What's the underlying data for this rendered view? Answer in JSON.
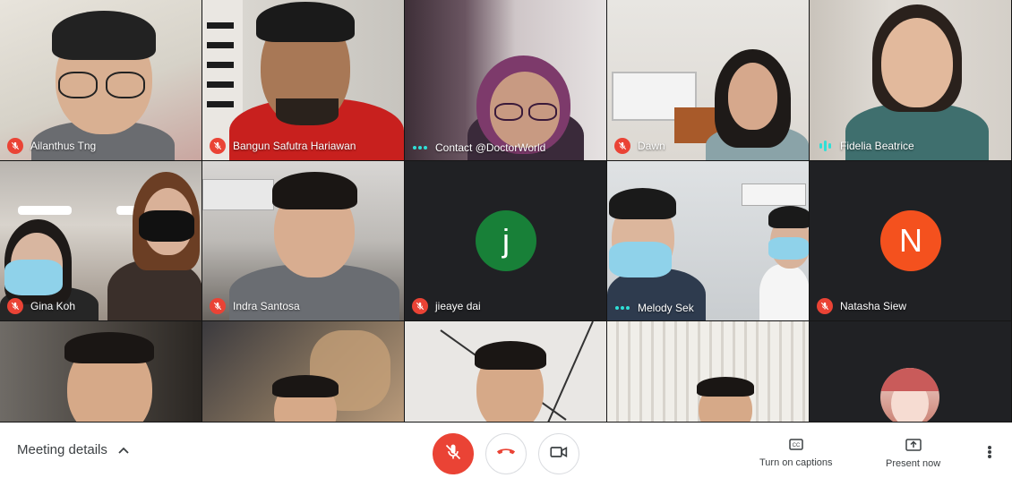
{
  "participants": [
    {
      "name": "Ailanthus Tng",
      "status": "muted"
    },
    {
      "name": "Bangun Safutra Hariawan",
      "status": "muted"
    },
    {
      "name": "Contact @DoctorWorld",
      "status": "connecting"
    },
    {
      "name": "Dawn",
      "status": "muted"
    },
    {
      "name": "Fidelia Beatrice",
      "status": "speaking"
    },
    {
      "name": "Gina Koh",
      "status": "muted"
    },
    {
      "name": "Indra Santosa",
      "status": "muted"
    },
    {
      "name": "jieaye dai",
      "status": "muted",
      "avatar_letter": "j",
      "avatar_color": "#188038"
    },
    {
      "name": "Melody Sek",
      "status": "connecting"
    },
    {
      "name": "Natasha Siew",
      "status": "muted",
      "avatar_letter": "N",
      "avatar_color": "#f4511e"
    }
  ],
  "bottom_bar": {
    "meeting_details_label": "Meeting details",
    "captions_label": "Turn on captions",
    "present_label": "Present now"
  },
  "colors": {
    "mute_red": "#ea4335",
    "speaking_teal": "#2fdfd7",
    "tile_dark": "#202124"
  },
  "icons": {
    "mic": "mic-off-icon",
    "hangup": "phone-hangup-icon",
    "camera": "video-camera-icon",
    "captions": "closed-captions-icon",
    "present": "present-screen-icon",
    "more": "more-vert-icon",
    "chevron": "chevron-up-icon"
  }
}
